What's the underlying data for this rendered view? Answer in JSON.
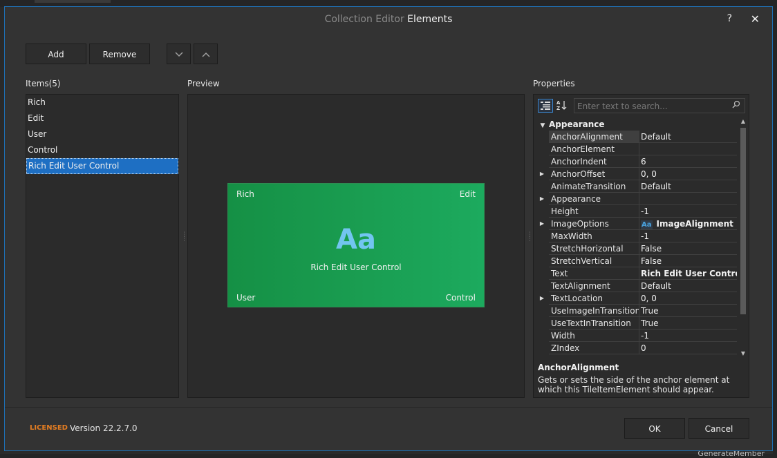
{
  "title": {
    "prefix": "Collection Editor",
    "name": "Elements"
  },
  "titlebar": {
    "help": "?",
    "close": "✕"
  },
  "toolbar": {
    "add": "Add",
    "remove": "Remove",
    "move_down": "⌄",
    "move_up": "⌃"
  },
  "items": {
    "label": "Items(5)",
    "list": [
      "Rich",
      "Edit",
      "User",
      "Control",
      "Rich Edit User Control"
    ],
    "selected_index": 4
  },
  "preview": {
    "label": "Preview",
    "tile": {
      "top_left": "Rich",
      "top_right": "Edit",
      "bottom_left": "User",
      "bottom_right": "Control",
      "glyph": "Aa",
      "center_text": "Rich Edit User Control",
      "background": "#1a9e52",
      "glyph_color": "#72c5f0"
    }
  },
  "properties": {
    "label": "Properties",
    "search_placeholder": "Enter text to search...",
    "category": "Appearance",
    "rows": [
      {
        "name": "AnchorAlignment",
        "value": "Default",
        "expandable": false,
        "bold": false,
        "selected": true
      },
      {
        "name": "AnchorElement",
        "value": "",
        "expandable": false,
        "bold": false
      },
      {
        "name": "AnchorIndent",
        "value": "6",
        "expandable": false,
        "bold": false
      },
      {
        "name": "AnchorOffset",
        "value": "0, 0",
        "expandable": true,
        "bold": false
      },
      {
        "name": "AnimateTransition",
        "value": "Default",
        "expandable": false,
        "bold": false
      },
      {
        "name": "Appearance",
        "value": "",
        "expandable": true,
        "bold": false
      },
      {
        "name": "Height",
        "value": "-1",
        "expandable": false,
        "bold": false
      },
      {
        "name": "ImageOptions",
        "value": "ImageAlignment =",
        "expandable": true,
        "bold": true,
        "icon": "Aa"
      },
      {
        "name": "MaxWidth",
        "value": "-1",
        "expandable": false,
        "bold": false
      },
      {
        "name": "StretchHorizontal",
        "value": "False",
        "expandable": false,
        "bold": false
      },
      {
        "name": "StretchVertical",
        "value": "False",
        "expandable": false,
        "bold": false
      },
      {
        "name": "Text",
        "value": "Rich Edit User Control",
        "expandable": false,
        "bold": true
      },
      {
        "name": "TextAlignment",
        "value": "Default",
        "expandable": false,
        "bold": false
      },
      {
        "name": "TextLocation",
        "value": "0, 0",
        "expandable": true,
        "bold": false
      },
      {
        "name": "UseImageInTransition",
        "value": "True",
        "expandable": false,
        "bold": false
      },
      {
        "name": "UseTextInTransition",
        "value": "True",
        "expandable": false,
        "bold": false
      },
      {
        "name": "Width",
        "value": "-1",
        "expandable": false,
        "bold": false
      },
      {
        "name": "ZIndex",
        "value": "0",
        "expandable": false,
        "bold": false
      }
    ],
    "description_title": "AnchorAlignment",
    "description_text": "Gets or sets the side of the anchor element at which this TileItemElement should appear."
  },
  "footer": {
    "licensed": "LICENSED",
    "version": "Version 22.2.7.0",
    "ok": "OK",
    "cancel": "Cancel"
  },
  "background": {
    "bottom_right_text": "GenerateMember"
  },
  "colors": {
    "accent": "#1e6fc3",
    "licensed": "#e67e22",
    "dialog_border": "#1f6fb2"
  }
}
